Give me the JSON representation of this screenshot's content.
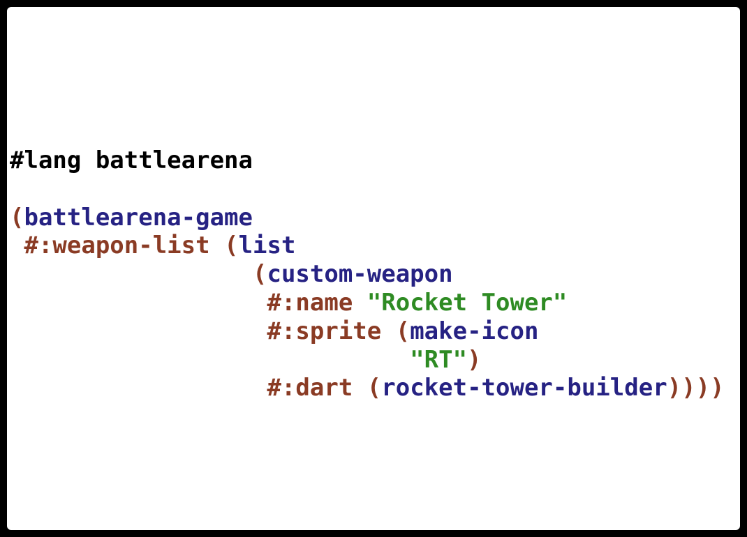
{
  "colors": {
    "background": "#000000",
    "editor_background": "#ffffff",
    "paren": "#8a3b24",
    "keyword": "#8a3b24",
    "identifier": "#262283",
    "string": "#2e8b23",
    "plain": "#000000"
  },
  "code": {
    "lang_line": "#lang battlearena",
    "line2": {
      "open": "(",
      "ident": "battlearena-game"
    },
    "line3": {
      "indent": " ",
      "keyword": "#:weapon-list",
      "space": " ",
      "open": "(",
      "ident": "list"
    },
    "line4": {
      "indent": "                 ",
      "open": "(",
      "ident": "custom-weapon"
    },
    "line5": {
      "indent": "                  ",
      "keyword": "#:name",
      "space": " ",
      "string": "\"Rocket Tower\""
    },
    "line6": {
      "indent": "                  ",
      "keyword": "#:sprite",
      "space": " ",
      "open": "(",
      "ident": "make-icon"
    },
    "line7": {
      "indent": "                            ",
      "string": "\"RT\"",
      "close": ")"
    },
    "line8": {
      "indent": "                  ",
      "keyword": "#:dart",
      "space": " ",
      "open": "(",
      "ident": "rocket-tower-builder",
      "close": "))))"
    }
  }
}
